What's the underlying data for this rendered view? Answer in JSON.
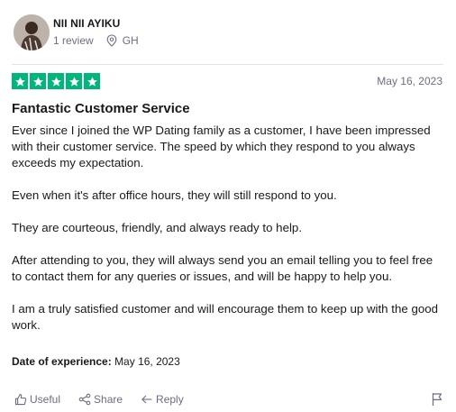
{
  "reviewer": {
    "name": "NII NII AYIKU",
    "review_count": "1 review",
    "country": "GH"
  },
  "review": {
    "rating": 5,
    "date": "May 16, 2023",
    "title": "Fantastic Customer Service",
    "paragraphs": [
      "Ever since I joined the WP Dating family as a customer, I have been impressed with their customer service. The speed by which they respond to you always exceeds my expectation.",
      "Even when it's after office hours, they will still respond to you.",
      "They are courteous, friendly, and always ready to help.",
      "After attending to you, they will always send you an email telling you to feel free to contact them for any queries or issues, and will be happy to help you.",
      "I am a truly satisfied customer and will encourage them to keep up with the good work."
    ],
    "experience_label": "Date of experience:",
    "experience_date": "May 16, 2023"
  },
  "actions": {
    "useful": "Useful",
    "share": "Share",
    "reply": "Reply"
  },
  "colors": {
    "star_green": "#00b67a",
    "muted_text": "#6c6c85"
  },
  "icons": {
    "location": "location-pin-icon",
    "useful": "thumbs-up-icon",
    "share": "share-icon",
    "reply": "reply-icon",
    "flag": "flag-icon"
  }
}
